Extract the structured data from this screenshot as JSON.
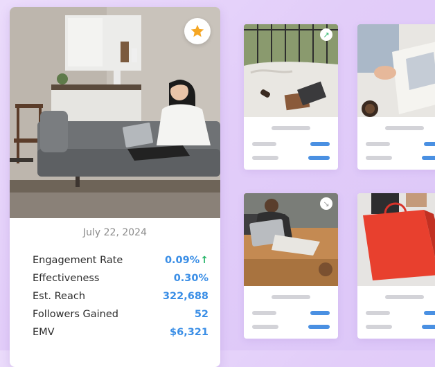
{
  "featured_post": {
    "date": "July 22, 2024",
    "favorite_icon": "star-icon",
    "metrics": [
      {
        "label": "Engagement Rate",
        "value": "0.09%",
        "trend": "↑"
      },
      {
        "label": "Effectiveness",
        "value": "0.30%"
      },
      {
        "label": "Est. Reach",
        "value": "322,688"
      },
      {
        "label": "Followers Gained",
        "value": "52"
      },
      {
        "label": "EMV",
        "value": "$6,321"
      }
    ]
  },
  "thumbnails": [
    {
      "badge_icon": "arrow-up-right-icon",
      "badge": "↗"
    },
    {},
    {
      "badge_icon": "arrow-down-right-icon",
      "badge": "↘"
    },
    {}
  ],
  "colors": {
    "accent_blue": "#4a90e2",
    "value_blue": "#3a8ee6",
    "trend_green": "#2ab56b",
    "star_orange": "#f5a623",
    "background_lavender": "#e2cdf9"
  }
}
